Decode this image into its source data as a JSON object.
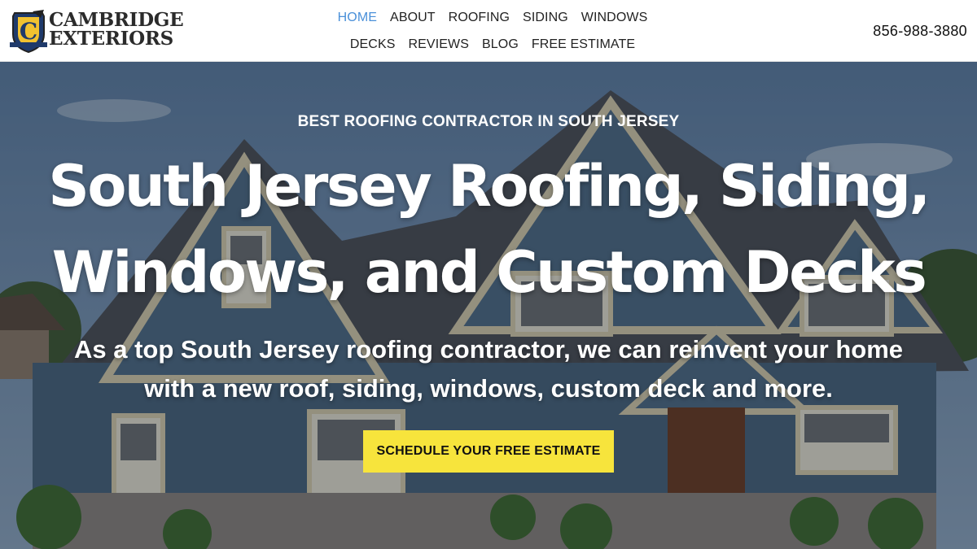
{
  "brand": {
    "logo_line1": "CAMBRIDGE",
    "logo_line2": "EXTERIORS",
    "badge_letter": "C",
    "logo_icon": "shield-badge-icon",
    "accent_color": "#4a90d9",
    "cta_color": "#f7e43c"
  },
  "nav": {
    "row1": [
      "HOME",
      "ABOUT",
      "ROOFING",
      "SIDING",
      "WINDOWS"
    ],
    "row2": [
      "DECKS",
      "REVIEWS",
      "BLOG",
      "FREE ESTIMATE"
    ],
    "active": "HOME"
  },
  "header": {
    "phone": "856-988-3880"
  },
  "hero": {
    "eyebrow": "BEST ROOFING CONTRACTOR IN SOUTH JERSEY",
    "title_line1": "South Jersey Roofing, Siding,",
    "title_line2": "Windows, and Custom Decks",
    "subtitle_line1": "As a top South Jersey roofing contractor, we can reinvent your home",
    "subtitle_line2": "with a new roof, siding, windows, custom deck and more.",
    "cta_label": "SCHEDULE YOUR FREE ESTIMATE"
  }
}
